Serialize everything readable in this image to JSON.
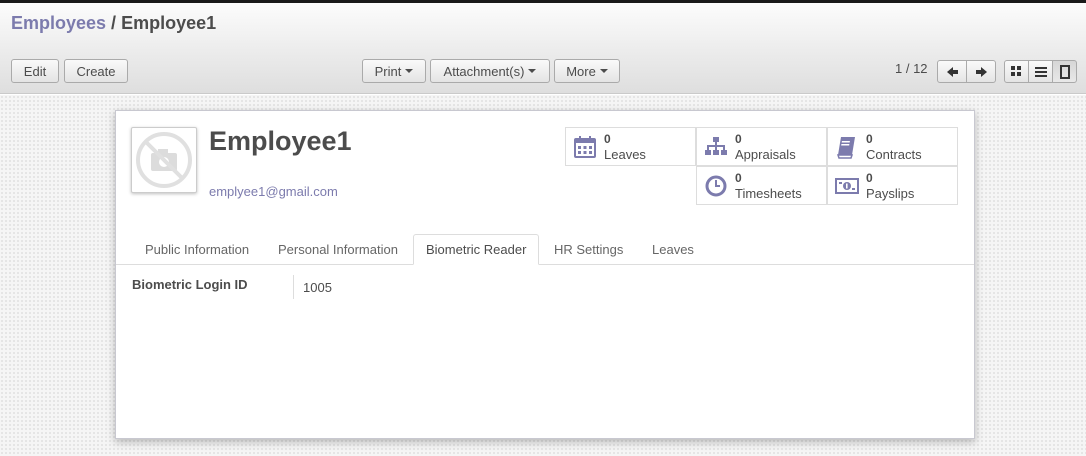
{
  "breadcrumb": {
    "parent": "Employees",
    "separator": "/",
    "current": "Employee1"
  },
  "toolbar": {
    "edit_label": "Edit",
    "create_label": "Create",
    "print_label": "Print",
    "attachments_label": "Attachment(s)",
    "more_label": "More"
  },
  "pager": {
    "value": "1 / 12"
  },
  "view_switcher": {
    "icons": [
      "kanban-view-icon",
      "list-view-icon",
      "form-view-icon"
    ],
    "active": "form-view-icon"
  },
  "employee": {
    "name": "Employee1",
    "email": "emplyee1@gmail.com"
  },
  "stat_buttons": [
    {
      "count": "0",
      "label": "Leaves",
      "icon": "calendar-icon"
    },
    {
      "count": "0",
      "label": "Appraisals",
      "icon": "sitemap-icon"
    },
    {
      "count": "0",
      "label": "Contracts",
      "icon": "book-icon"
    },
    {
      "count": "0",
      "label": "Timesheets",
      "icon": "clock-icon"
    },
    {
      "count": "0",
      "label": "Payslips",
      "icon": "money-icon"
    }
  ],
  "tabs": [
    {
      "label": "Public Information"
    },
    {
      "label": "Personal Information"
    },
    {
      "label": "Biometric Reader",
      "active": true
    },
    {
      "label": "HR Settings"
    },
    {
      "label": "Leaves"
    }
  ],
  "fields": {
    "biometric_login_id_label": "Biometric Login ID",
    "biometric_login_id_value": "1005"
  },
  "colors": {
    "accent": "#7c7bad",
    "text": "#4c4c4c"
  }
}
